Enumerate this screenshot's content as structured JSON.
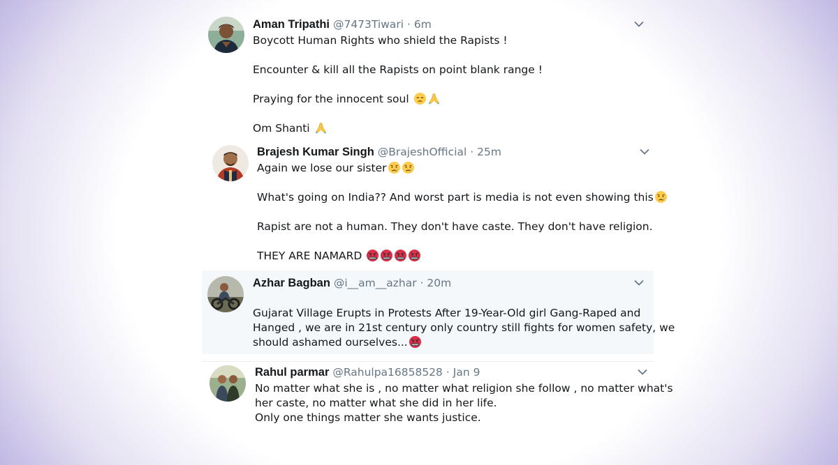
{
  "tweets": [
    {
      "name": "Aman Tripathi",
      "handle": "@7473Tiwari",
      "time": "6m",
      "paragraphs": [
        "Boycott Human Rights who shield the Rapists !",
        "Encounter & kill all the Rapists on point blank range !",
        "Praying for the innocent soul",
        "Om Shanti"
      ]
    },
    {
      "name": "Brajesh Kumar Singh",
      "handle": "@BrajeshOfficial",
      "time": "25m",
      "paragraphs": [
        "Again we lose our sister",
        "What's going on India?? And worst part is media is not even showing this",
        "Rapist are not a human. They don't have caste. They don't have religion.",
        "THEY ARE NAMARD"
      ]
    },
    {
      "name": "Azhar Bagban",
      "handle": "@i__am__azhar",
      "time": "20m",
      "lines": [
        "Gujarat Village Erupts in Protests After 19-Year-Old  girl  Gang-Raped and",
        "Hanged , we are in 21st century only country still fights for women safety, we",
        "should ashamed ourselves..."
      ]
    },
    {
      "name": "Rahul parmar",
      "handle": "@Rahulpa16858528",
      "time": "Jan 9",
      "lines": [
        "No matter what she is , no matter what religion she follow , no matter what's",
        "her caste, no matter what she did in her life.",
        "Only one things matter she wants justice."
      ]
    }
  ],
  "separator": "·",
  "icons": {
    "menu": "chevron-down-icon",
    "emoji_pensive": "pensive-face-emoji",
    "emoji_pray": "folded-hands-emoji",
    "emoji_cry": "crying-face-emoji",
    "emoji_angry": "cursing-face-emoji"
  },
  "colors": {
    "name": "#14171a",
    "handle": "#657786",
    "highlight_bg": "#f5f8fa",
    "chevron": "#657786"
  }
}
